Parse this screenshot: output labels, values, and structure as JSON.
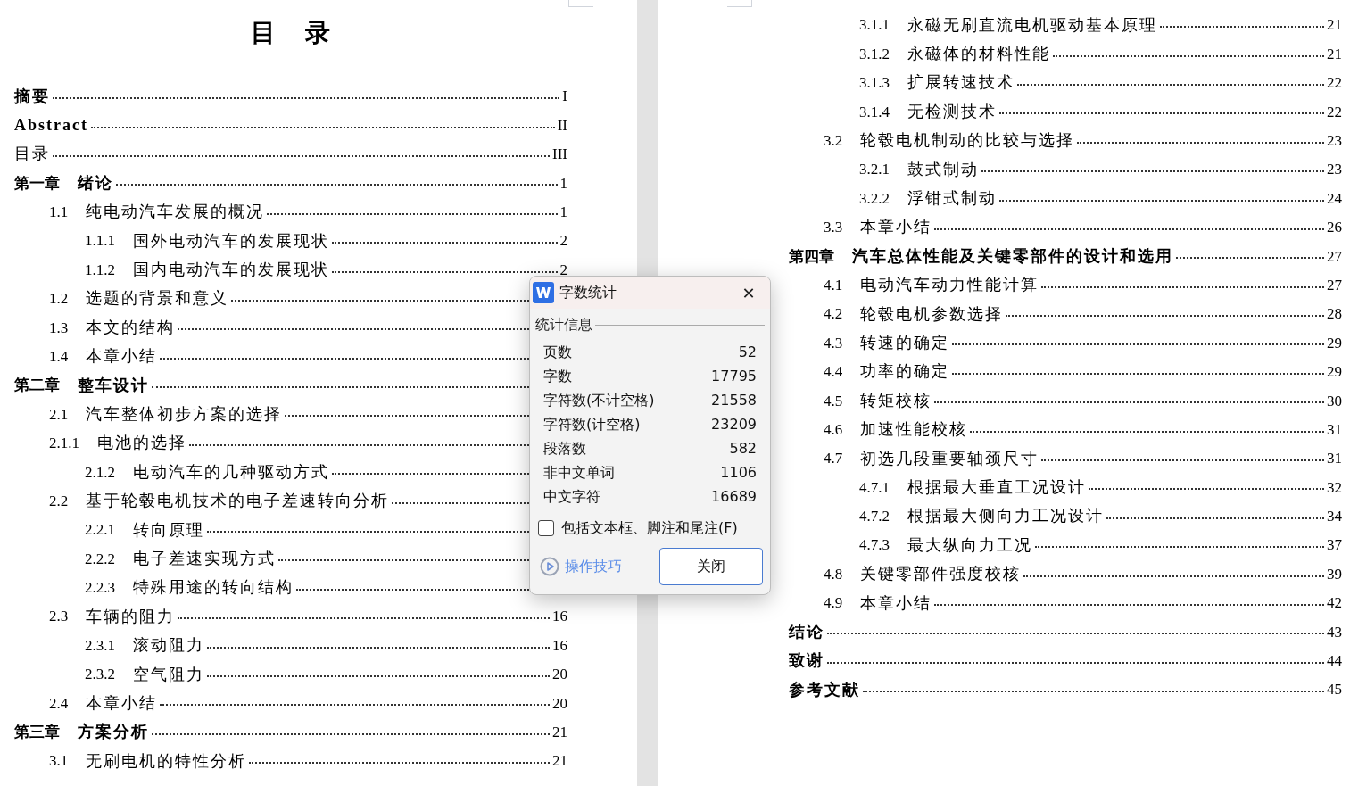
{
  "left_page": {
    "title": "目 录",
    "entries": [
      {
        "kind": "heading",
        "title": "摘要",
        "page": "I"
      },
      {
        "kind": "heading",
        "title": "Abstract",
        "page": "II"
      },
      {
        "kind": "plain",
        "title": "目录",
        "page": "III"
      },
      {
        "kind": "chapter",
        "number": "第一章",
        "title": "绪论",
        "page": "1"
      },
      {
        "kind": "section",
        "number": "1.1",
        "title": "纯电动汽车发展的概况",
        "page": "1"
      },
      {
        "kind": "subsection",
        "number": "1.1.1",
        "title": "国外电动汽车的发展现状",
        "page": "2"
      },
      {
        "kind": "subsection",
        "number": "1.1.2",
        "title": "国内电动汽车的发展现状",
        "page": "2"
      },
      {
        "kind": "section",
        "number": "1.2",
        "title": "选题的背景和意义"
      },
      {
        "kind": "section",
        "number": "1.3",
        "title": "本文的结构"
      },
      {
        "kind": "section",
        "number": "1.4",
        "title": "本章小结"
      },
      {
        "kind": "chapter",
        "number": "第二章",
        "title": "整车设计"
      },
      {
        "kind": "section",
        "number": "2.1",
        "title": "汽车整体初步方案的选择"
      },
      {
        "kind": "section",
        "number": "2.1.1",
        "title": "电池的选择"
      },
      {
        "kind": "subsection",
        "number": "2.1.2",
        "title": "电动汽车的几种驱动方式"
      },
      {
        "kind": "section",
        "number": "2.2",
        "title": "基于轮毂电机技术的电子差速转向分析"
      },
      {
        "kind": "subsection",
        "number": "2.2.1",
        "title": "转向原理"
      },
      {
        "kind": "subsection",
        "number": "2.2.2",
        "title": "电子差速实现方式"
      },
      {
        "kind": "subsection",
        "number": "2.2.3",
        "title": "特殊用途的转向结构"
      },
      {
        "kind": "section",
        "number": "2.3",
        "title": "车辆的阻力",
        "page": "16"
      },
      {
        "kind": "subsection",
        "number": "2.3.1",
        "title": "滚动阻力",
        "page": "16"
      },
      {
        "kind": "subsection",
        "number": "2.3.2",
        "title": "空气阻力",
        "page": "20"
      },
      {
        "kind": "section",
        "number": "2.4",
        "title": "本章小结",
        "page": "20"
      },
      {
        "kind": "chapter",
        "number": "第三章",
        "title": "方案分析",
        "page": "21"
      },
      {
        "kind": "section",
        "number": "3.1",
        "title": "无刷电机的特性分析",
        "page": "21"
      }
    ]
  },
  "right_page": {
    "entries": [
      {
        "kind": "subsection",
        "number": "3.1.1",
        "title": "永磁无刷直流电机驱动基本原理",
        "page": "21"
      },
      {
        "kind": "subsection",
        "number": "3.1.2",
        "title": "永磁体的材料性能",
        "page": "21"
      },
      {
        "kind": "subsection",
        "number": "3.1.3",
        "title": "扩展转速技术",
        "page": "22"
      },
      {
        "kind": "subsection",
        "number": "3.1.4",
        "title": "无检测技术",
        "page": "22"
      },
      {
        "kind": "section",
        "number": "3.2",
        "title": "轮毂电机制动的比较与选择",
        "page": "23"
      },
      {
        "kind": "subsection",
        "number": "3.2.1",
        "title": "鼓式制动",
        "page": "23"
      },
      {
        "kind": "subsection",
        "number": "3.2.2",
        "title": "浮钳式制动",
        "page": "24"
      },
      {
        "kind": "section",
        "number": "3.3",
        "title": "本章小结",
        "page": "26"
      },
      {
        "kind": "chapter",
        "number": "第四章",
        "title": "汽车总体性能及关键零部件的设计和选用",
        "page": "27"
      },
      {
        "kind": "section",
        "number": "4.1",
        "title": "电动汽车动力性能计算",
        "page": "27"
      },
      {
        "kind": "section",
        "number": "4.2",
        "title": "轮毂电机参数选择",
        "page": "28"
      },
      {
        "kind": "section",
        "number": "4.3",
        "title": "转速的确定",
        "page": "29"
      },
      {
        "kind": "section",
        "number": "4.4",
        "title": "功率的确定",
        "page": "29"
      },
      {
        "kind": "section",
        "number": "4.5",
        "title": "转矩校核",
        "page": "30"
      },
      {
        "kind": "section",
        "number": "4.6",
        "title": "加速性能校核",
        "page": "31"
      },
      {
        "kind": "section",
        "number": "4.7",
        "title": "初选几段重要轴颈尺寸",
        "page": "31"
      },
      {
        "kind": "subsection",
        "number": "4.7.1",
        "title": "根据最大垂直工况设计",
        "page": "32"
      },
      {
        "kind": "subsection",
        "number": "4.7.2",
        "title": "根据最大侧向力工况设计",
        "page": "34"
      },
      {
        "kind": "subsection",
        "number": "4.7.3",
        "title": "最大纵向力工况",
        "page": "37"
      },
      {
        "kind": "section",
        "number": "4.8",
        "title": "关键零部件强度校核",
        "page": "39"
      },
      {
        "kind": "section",
        "number": "4.9",
        "title": "本章小结",
        "page": "42"
      },
      {
        "kind": "heading",
        "title": "结论",
        "page": "43"
      },
      {
        "kind": "heading",
        "title": "致谢",
        "page": "44"
      },
      {
        "kind": "heading",
        "title": "参考文献",
        "page": "45"
      }
    ]
  },
  "dialog": {
    "title": "字数统计",
    "close": "✕",
    "group": "统计信息",
    "stats": [
      {
        "label": "页数",
        "value": "52"
      },
      {
        "label": "字数",
        "value": "17795"
      },
      {
        "label": "字符数(不计空格)",
        "value": "21558"
      },
      {
        "label": "字符数(计空格)",
        "value": "23209"
      },
      {
        "label": "段落数",
        "value": "582"
      },
      {
        "label": "非中文单词",
        "value": "1106"
      },
      {
        "label": "中文字符",
        "value": "16689"
      }
    ],
    "checkbox": {
      "label": "包括文本框、脚注和尾注(F)",
      "checked": false
    },
    "tips_link": "操作技巧",
    "close_button": "关闭"
  }
}
